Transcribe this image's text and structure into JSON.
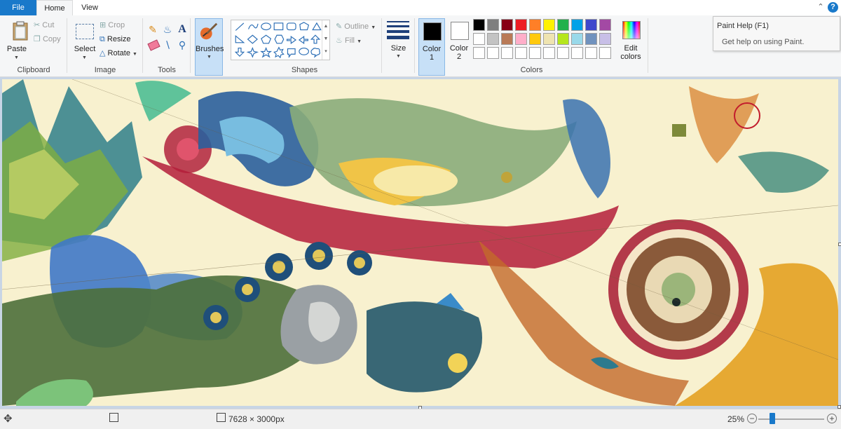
{
  "tabs": {
    "file": "File",
    "home": "Home",
    "view": "View"
  },
  "help_icon": "?",
  "ribbon": {
    "clipboard": {
      "label": "Clipboard",
      "paste": "Paste",
      "cut": "Cut",
      "copy": "Copy"
    },
    "image": {
      "label": "Image",
      "select": "Select",
      "crop": "Crop",
      "resize": "Resize",
      "rotate": "Rotate"
    },
    "tools": {
      "label": "Tools"
    },
    "brushes": {
      "label": "Brushes"
    },
    "shapes": {
      "label": "Shapes",
      "outline": "Outline",
      "fill": "Fill"
    },
    "size": {
      "label": "Size"
    },
    "colors": {
      "label": "Colors",
      "color1_line1": "Color",
      "color1_line2": "1",
      "color2_line1": "Color",
      "color2_line2": "2",
      "edit_line1": "Edit",
      "edit_line2": "colors",
      "color1_value": "#000000",
      "color2_value": "#ffffff",
      "palette_row1": [
        "#000000",
        "#7f7f7f",
        "#880015",
        "#ed1c24",
        "#ff7f27",
        "#fff200",
        "#22b14c",
        "#00a2e8",
        "#3f48cc",
        "#a349a4"
      ],
      "palette_row2": [
        "#ffffff",
        "#c3c3c3",
        "#b97a57",
        "#ffaec9",
        "#ffc90e",
        "#efe4b0",
        "#b5e61d",
        "#99d9ea",
        "#7092be",
        "#c8bfe7"
      ],
      "palette_row3": [
        "#ffffff",
        "#ffffff",
        "#ffffff",
        "#ffffff",
        "#ffffff",
        "#ffffff",
        "#ffffff",
        "#ffffff",
        "#ffffff",
        "#ffffff"
      ]
    }
  },
  "help_tooltip": {
    "title": "Paint Help (F1)",
    "description": "Get help on using Paint."
  },
  "canvas": {
    "content": "colorful abstract illustration"
  },
  "status": {
    "image_size": "7628 × 3000px",
    "zoom": "25%"
  },
  "icons": [
    "paste-icon",
    "cut-icon",
    "copy-icon",
    "select-icon",
    "crop-icon",
    "resize-icon",
    "rotate-icon",
    "pencil-icon",
    "fill-bucket-icon",
    "text-icon",
    "eraser-icon",
    "color-picker-icon",
    "magnifier-icon",
    "brush-icon",
    "size-icon",
    "edit-colors-icon",
    "help-icon",
    "collapse-ribbon-icon",
    "move-cursor-icon",
    "selection-size-icon",
    "image-size-icon",
    "zoom-out-icon",
    "zoom-in-icon"
  ]
}
